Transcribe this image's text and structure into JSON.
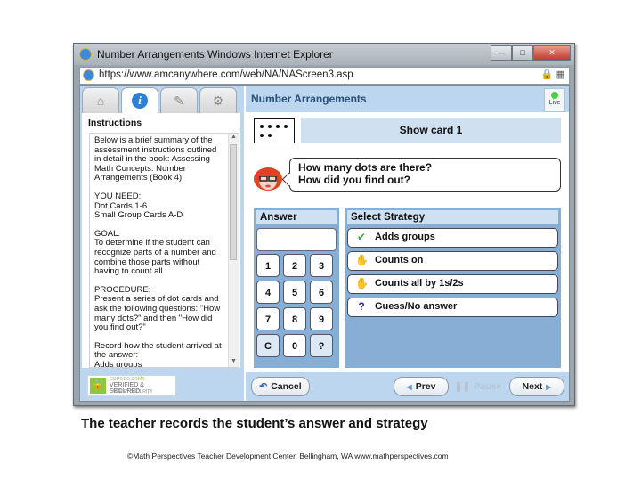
{
  "window": {
    "title": "Number Arrangements   Windows Internet Explorer",
    "url": "https://www.amcanywhere.com/web/NA/NAScreen3.asp",
    "controls": {
      "minimize": "—",
      "maximize": "□",
      "close": "✕"
    }
  },
  "sidebar": {
    "tabs": [
      {
        "name": "home",
        "icon": "⌂"
      },
      {
        "name": "info",
        "icon": "i"
      },
      {
        "name": "notes",
        "icon": "✎"
      },
      {
        "name": "settings",
        "icon": "⚙"
      }
    ],
    "instructions_title": "Instructions",
    "instructions_paragraphs": [
      "Below is a brief summary of the assessment instructions outlined in detail in the book: Assessing Math Concepts: Number Arrangements (Book 4).",
      "YOU NEED:\nDot Cards 1-6\nSmall Group Cards A-D",
      "GOAL:\nTo determine if the student can recognize parts of a number and combine those parts without having to count all",
      "PROCEDURE:\nPresent a series of dot cards and ask the following questions: \"How many dots?\" and then \"How did you find out?\"",
      "Record how the student arrived at the answer:\nAdds groups"
    ],
    "badge": {
      "line1": "COMODO.COM®",
      "line2": "VERIFIED & SECURED",
      "line3": "VERIFY SECURITY"
    }
  },
  "main": {
    "title": "Number Arrangements",
    "live_label": "Live",
    "live_color": "#47d13a",
    "card_dot_count": 6,
    "show_card_label": "Show card 1",
    "question_line1": "How many dots are there?",
    "question_line2": "How did you find out?",
    "answer": {
      "header": "Answer",
      "value": "",
      "keys": [
        "1",
        "2",
        "3",
        "4",
        "5",
        "6",
        "7",
        "8",
        "9",
        "C",
        "0",
        "?"
      ]
    },
    "strategy": {
      "header": "Select Strategy",
      "options": [
        {
          "icon": "✔",
          "icon_name": "checkmark-icon",
          "color": "#3aa33a",
          "label": "Adds groups"
        },
        {
          "icon": "✋",
          "icon_name": "hand-icon",
          "color": "#555555",
          "label": "Counts on"
        },
        {
          "icon": "✋",
          "icon_name": "hands-icon",
          "color": "#555555",
          "label": "Counts all by 1s/2s"
        },
        {
          "icon": "?",
          "icon_name": "question-icon",
          "color": "#2b2b8a",
          "label": "Guess/No answer"
        }
      ]
    },
    "footer": {
      "cancel": "Cancel",
      "prev": "Prev",
      "pause": "Pause",
      "next": "Next"
    }
  },
  "caption": "The teacher records the student’s answer and strategy",
  "copyright": "©Math Perspectives Teacher Development Center, Bellingham, WA www.mathperspectives.com"
}
